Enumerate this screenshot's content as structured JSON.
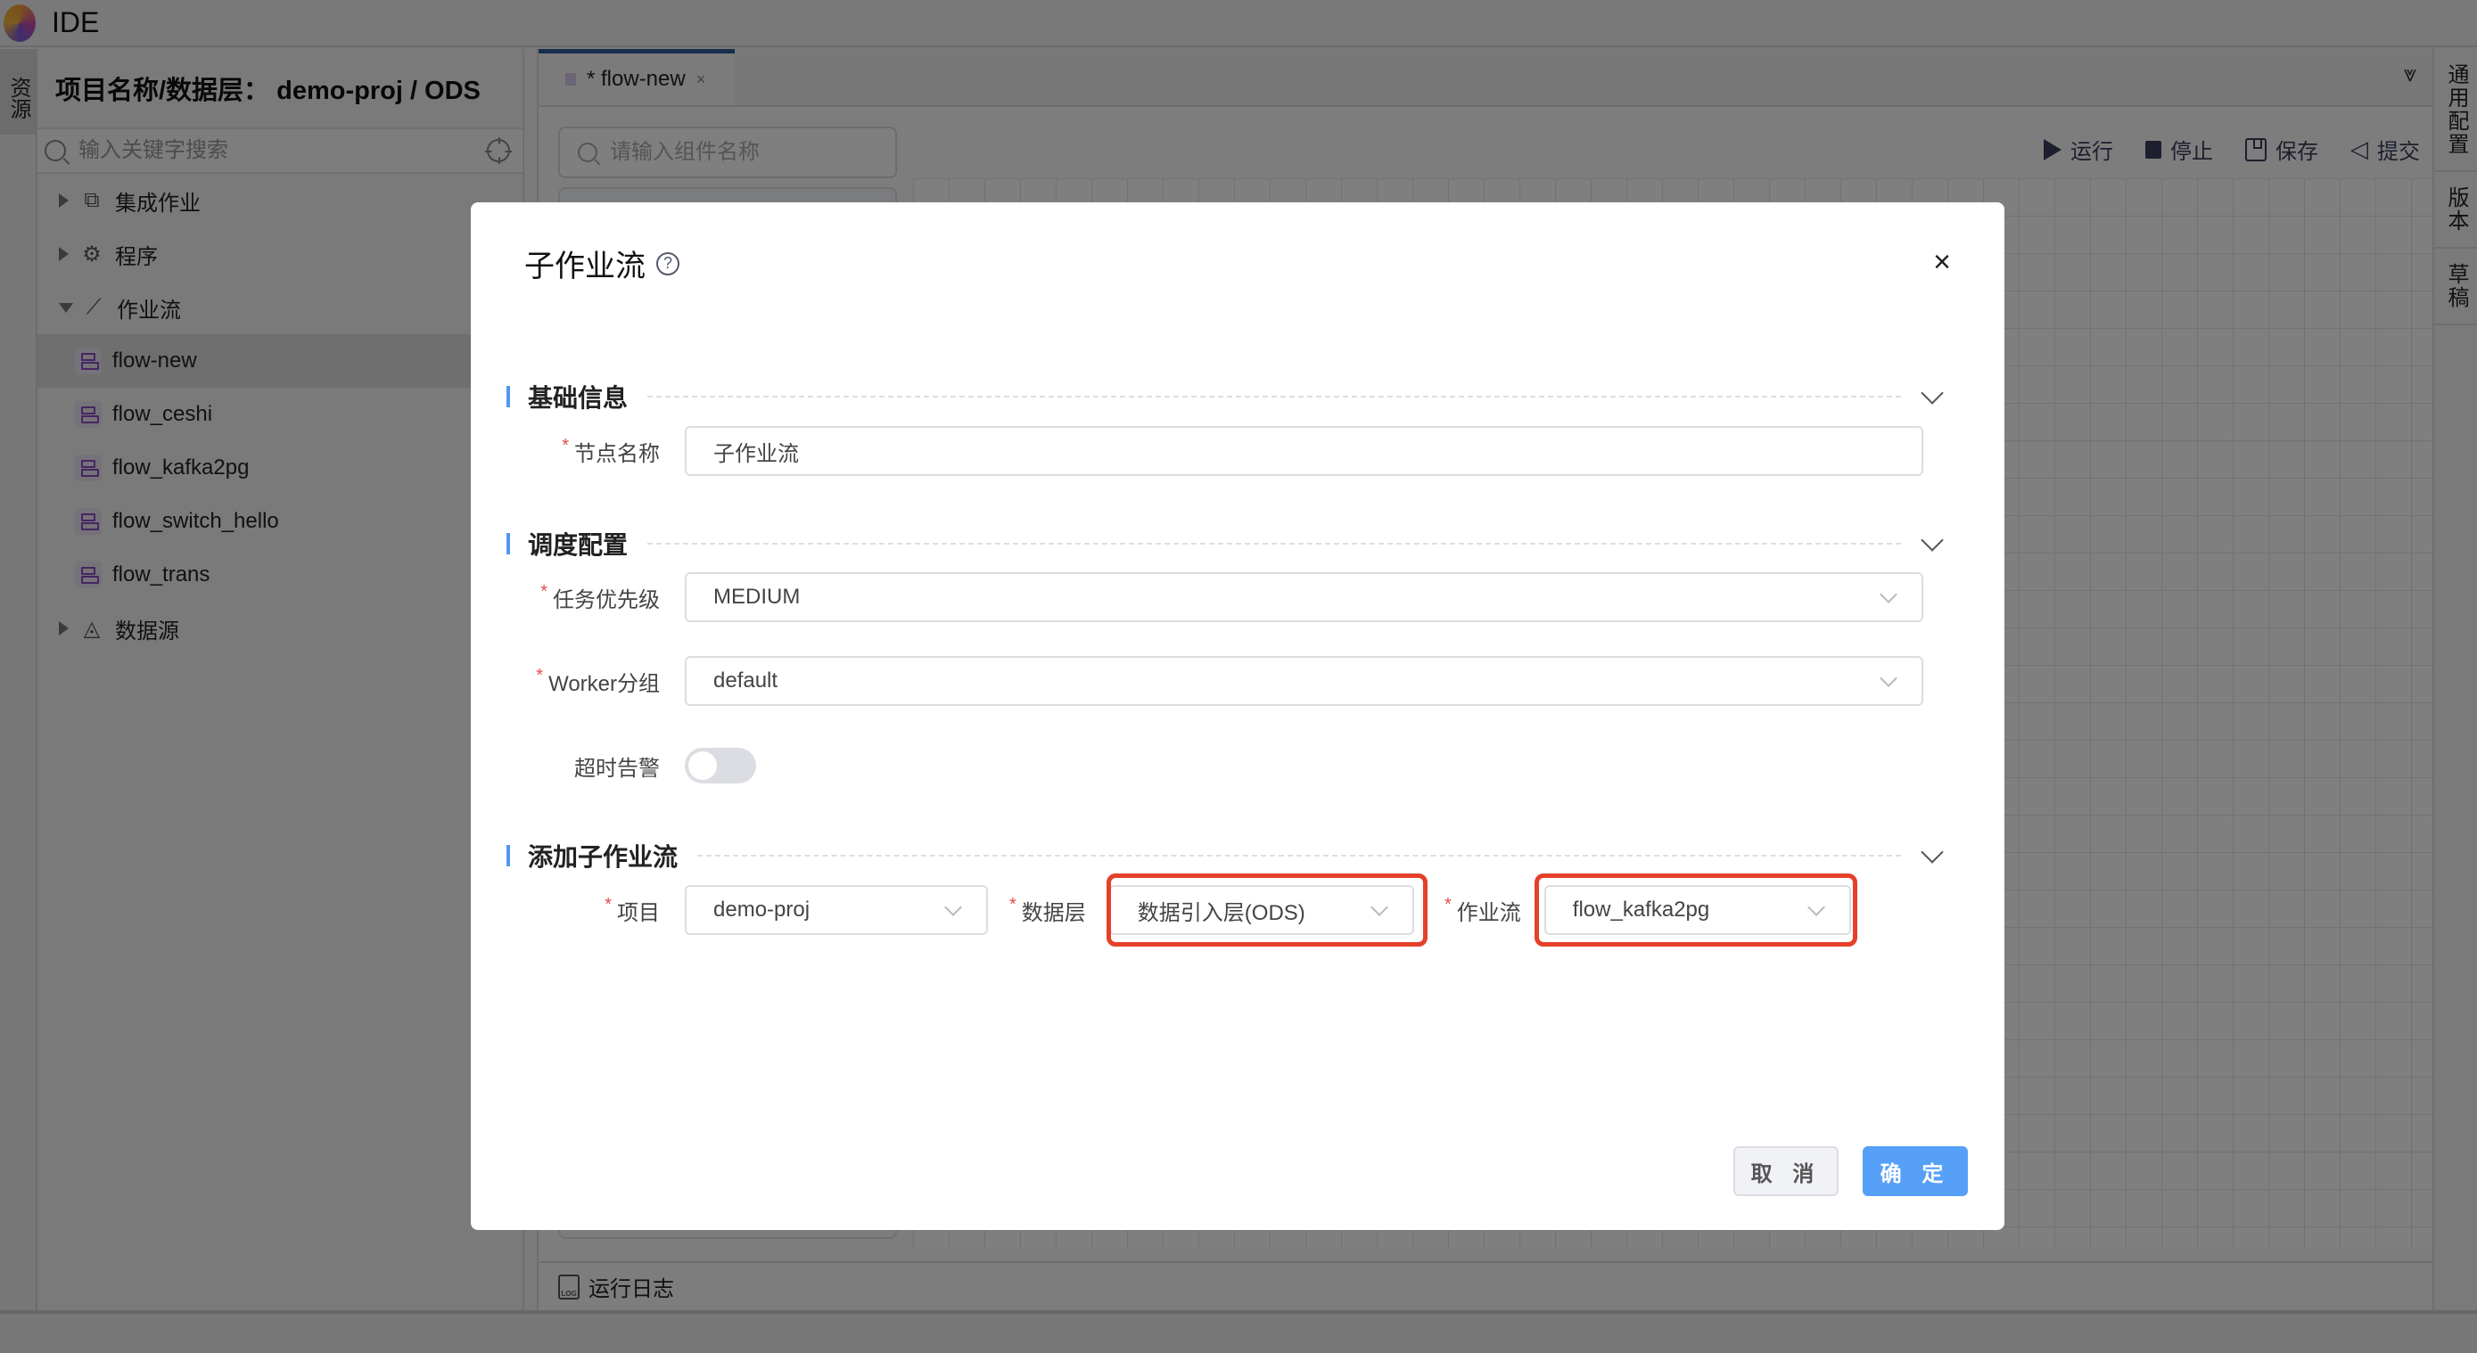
{
  "app": {
    "title": "IDE"
  },
  "left_strip": {
    "tab_label": "资源"
  },
  "sidebar": {
    "header": "项目名称/数据层： demo-proj / ODS",
    "search_placeholder": "输入关键字搜索",
    "tree": [
      {
        "label": "集成作业",
        "icon": "integration-job-icon",
        "expanded": false
      },
      {
        "label": "程序",
        "icon": "gear-icon",
        "expanded": false
      },
      {
        "label": "作业流",
        "icon": "workflow-icon",
        "expanded": true,
        "children": [
          "flow-new",
          "flow_ceshi",
          "flow_kafka2pg",
          "flow_switch_hello",
          "flow_trans"
        ]
      },
      {
        "label": "数据源",
        "icon": "datasource-icon",
        "expanded": false
      }
    ],
    "selected_item": "flow-new"
  },
  "main": {
    "tab": {
      "label": "* flow-new",
      "close": "×"
    },
    "component_search_placeholder": "请输入组件名称",
    "actions": {
      "run": "运行",
      "stop": "停止",
      "save": "保存",
      "submit": "提交"
    },
    "log_label": "运行日志",
    "log_icon_text": "LOG"
  },
  "right_strip": {
    "tabs": [
      "通用配置",
      "版本",
      "草稿"
    ]
  },
  "modal": {
    "title": "子作业流",
    "close": "×",
    "sections": {
      "basic": "基础信息",
      "schedule": "调度配置",
      "subflow": "添加子作业流"
    },
    "fields": {
      "node_name": {
        "label": "节点名称",
        "value": "子作业流",
        "required": true
      },
      "priority": {
        "label": "任务优先级",
        "value": "MEDIUM",
        "required": true
      },
      "worker_group": {
        "label": "Worker分组",
        "value": "default",
        "required": true
      },
      "timeout_alert": {
        "label": "超时告警",
        "enabled": false
      },
      "project": {
        "label": "项目",
        "value": "demo-proj",
        "required": true
      },
      "data_layer": {
        "label": "数据层",
        "value": "数据引入层(ODS)",
        "required": true
      },
      "workflow": {
        "label": "作业流",
        "value": "flow_kafka2pg",
        "required": true
      }
    },
    "required_mark": "*",
    "help_icon": "?",
    "buttons": {
      "cancel": "取 消",
      "ok": "确 定"
    }
  },
  "colors": {
    "primary": "#56a0f7",
    "highlight": "#e5402a",
    "required": "#e24d4d",
    "section_bar": "#4f97f0"
  }
}
